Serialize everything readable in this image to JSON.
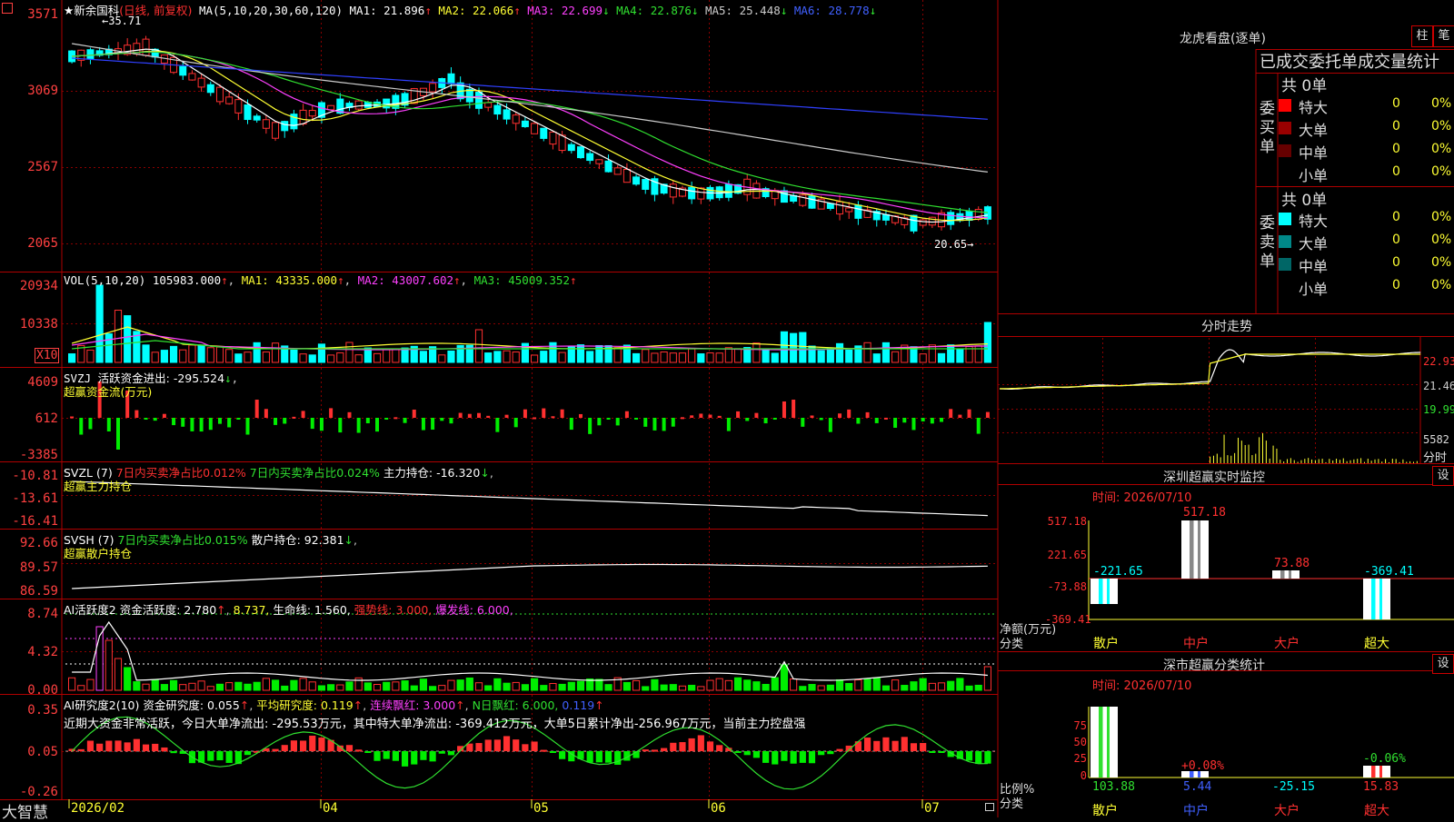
{
  "stock": {
    "name": "★新余国科",
    "period": "(日线, 前复权)",
    "ma_title": "MA(5,10,20,30,60,120)",
    "ma_values": [
      {
        "label": "MA1: 21.896",
        "arrow": "↑",
        "color": "#ffffff"
      },
      {
        "label": "MA2: 22.066",
        "arrow": "↑",
        "color": "#ffff33"
      },
      {
        "label": "MA3: 22.699",
        "arrow": "↓",
        "color": "#ff40ff"
      },
      {
        "label": "MA4: 22.876",
        "arrow": "↓",
        "color": "#30e030"
      },
      {
        "label": "MA5: 25.448",
        "arrow": "↓",
        "color": "#cccccc"
      },
      {
        "label": "MA6: 28.778",
        "arrow": "↓",
        "color": "#4060ff"
      }
    ],
    "high_label": "←35.71",
    "low_label": "20.65→"
  },
  "price_axis": [
    "3571",
    "3069",
    "2567",
    "2065"
  ],
  "vol": {
    "header": "VOL(5,10,20)",
    "value": "105983.000",
    "ma1": "MA1: 43335.000",
    "ma2": "MA2: 43007.602",
    "ma3": "MA3: 45009.352",
    "axis": [
      "20934",
      "10338"
    ],
    "unit": "X10"
  },
  "svzj": {
    "header": "SVZJ",
    "desc": "活跃资金进出: -295.524",
    "sub": "超赢资金流(万元)",
    "axis": [
      "4609",
      "612",
      "-3385"
    ]
  },
  "svzl": {
    "header": "SVZL (7)",
    "p1": "7日内买卖净占比0.012%",
    "p2": "7日内买卖净占比0.024%",
    "p3": "主力持仓: -16.320",
    "sub": "超赢主力持仓",
    "axis": [
      "-10.81",
      "-13.61",
      "-16.41"
    ]
  },
  "svsh": {
    "header": "SVSH (7)",
    "p1": "7日内买卖净占比0.015%",
    "p2": "散户持仓: 92.381",
    "sub": "超赢散户持仓",
    "axis": [
      "92.66",
      "89.57",
      "86.59"
    ]
  },
  "ai1": {
    "header": "AI活跃度2",
    "p1": "资金活跃度: 2.780",
    "p2": "8.737,",
    "p3": "生命线: 1.560,",
    "p4": "强势线: 3.000,",
    "p5": "爆发线: 6.000,",
    "axis": [
      "8.74",
      "4.32",
      "0.00"
    ]
  },
  "ai2": {
    "header": "AI研究度2(10)",
    "p1": "资金研究度: 0.055",
    "p2": "平均研究度: 0.119",
    "p3": "连续飘红: 3.000",
    "p4": "N日飘红: 6.000,",
    "p5": "0.119",
    "comment": "近期大资金非常活跃，今日大单净流出: -295.53万元，其中特大单净流出: -369.412万元，大单5日累计净出-256.967万元，当前主力控盘强",
    "axis": [
      "0.35",
      "0.05",
      "-0.26"
    ]
  },
  "x_axis": {
    "brand": "大智慧",
    "labels": [
      "2026/02",
      "04",
      "05",
      "06",
      "07"
    ]
  },
  "right": {
    "dragon_title": "龙虎看盘(逐单)",
    "btn_col": "柱",
    "btn_bi": "笔",
    "stat_title": "已成交委托单成交量统计",
    "buy_side": "委买单",
    "sell_side": "委卖单",
    "buy_total": "共 0单",
    "sell_total": "共 0单",
    "rows": [
      {
        "name": "特大",
        "v1": "0",
        "v2": "0%"
      },
      {
        "name": "大单",
        "v1": "0",
        "v2": "0%"
      },
      {
        "name": "中单",
        "v1": "0",
        "v2": "0%"
      },
      {
        "name": "小单",
        "v1": "0",
        "v2": "0%"
      }
    ],
    "intraday_title": "分时走势",
    "intraday_axis": [
      "22.93",
      "21.46",
      "19.99"
    ],
    "intraday_vol": "5582",
    "intraday_unit": "分时",
    "monitor_title": "深圳超赢实时监控",
    "monitor_setting": "设",
    "monitor_time": "时间: 2026/07/10",
    "monitor_axis": [
      "517.18",
      "221.65",
      "-73.88",
      "-369.41"
    ],
    "monitor_values": [
      "-221.65",
      "517.18",
      "73.88",
      "-369.41"
    ],
    "monitor_ylabel": "净额(万元)",
    "monitor_xlabel": "分类",
    "categories": [
      "散户",
      "中户",
      "大户",
      "超大"
    ],
    "class_title": "深市超赢分类统计",
    "class_setting": "设",
    "class_time": "时间: 2026/07/10",
    "class_axis": [
      "75",
      "50",
      "25",
      "0"
    ],
    "class_pct": [
      "+0.08%",
      "-0.06%"
    ],
    "class_values": [
      "103.88",
      "5.44",
      "-25.15",
      "15.83"
    ],
    "class_ylabel": "比例%",
    "class_xlabel": "分类"
  },
  "colors": {
    "up": "#ff3030",
    "down": "#00ffff",
    "grid": "#b00000"
  }
}
